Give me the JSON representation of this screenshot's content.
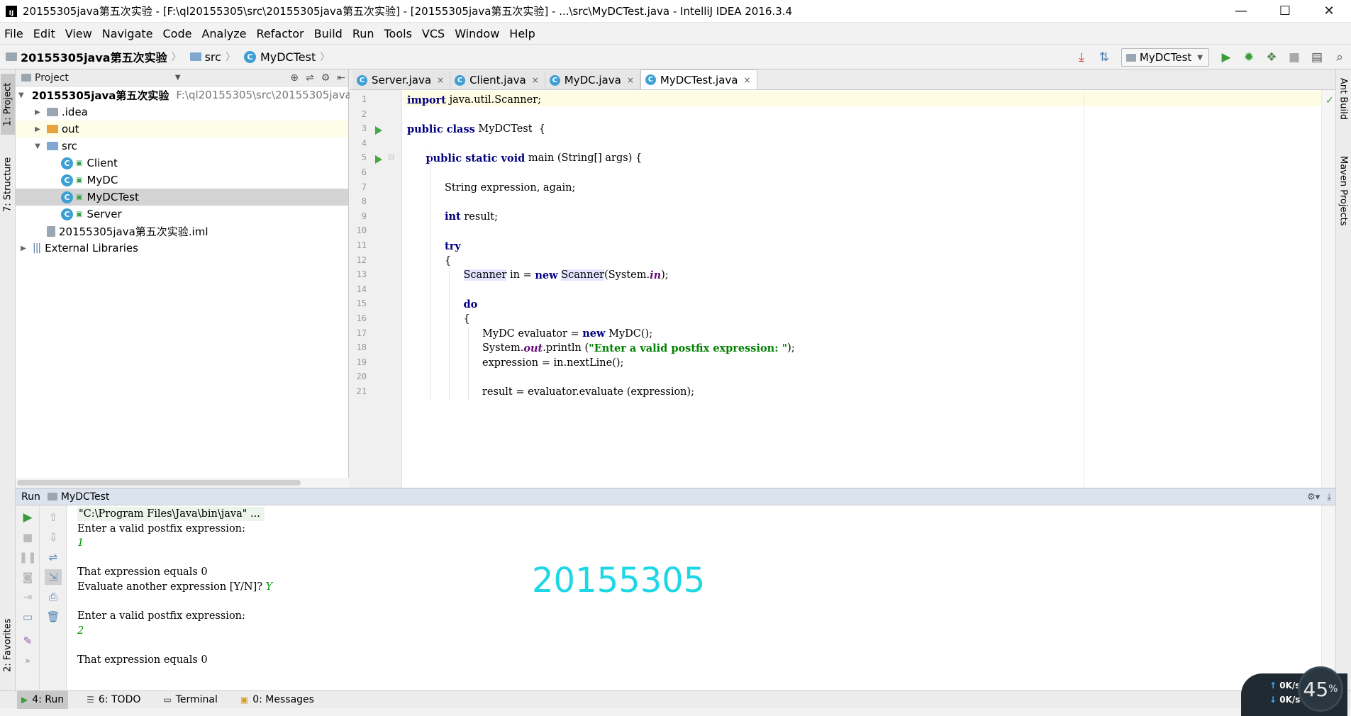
{
  "window": {
    "title": "20155305java第五次实验 - [F:\\ql20155305\\src\\20155305java第五次实验] - [20155305java第五次实验] - ...\\src\\MyDCTest.java - IntelliJ IDEA 2016.3.4",
    "minimize": "—",
    "maximize": "☐",
    "close": "✕"
  },
  "menu": [
    "File",
    "Edit",
    "View",
    "Navigate",
    "Code",
    "Analyze",
    "Refactor",
    "Build",
    "Run",
    "Tools",
    "VCS",
    "Window",
    "Help"
  ],
  "breadcrumb": {
    "project": "20155305java第五次实验",
    "folder": "src",
    "file": "MyDCTest"
  },
  "toolbar": {
    "run_config": "MyDCTest"
  },
  "left_stripe": {
    "project_tab": "1: Project",
    "structure_tab": "7: Structure",
    "favorites_tab": "2: Favorites"
  },
  "right_stripe": {
    "ant_tab": "Ant Build",
    "maven_tab": "Maven Projects"
  },
  "project_panel": {
    "title": "Project",
    "tree": [
      {
        "label": "20155305java第五次实验",
        "path": "F:\\ql20155305\\src\\20155305java",
        "indent": 0,
        "arrow": "▼",
        "icon": "module"
      },
      {
        "label": ".idea",
        "indent": 1,
        "arrow": "▶",
        "icon": "folder-gray"
      },
      {
        "label": "out",
        "indent": 1,
        "arrow": "▶",
        "icon": "folder-orange"
      },
      {
        "label": "src",
        "indent": 1,
        "arrow": "▼",
        "icon": "folder-blue"
      },
      {
        "label": "Client",
        "indent": 2,
        "arrow": "",
        "icon": "class"
      },
      {
        "label": "MyDC",
        "indent": 2,
        "arrow": "",
        "icon": "class"
      },
      {
        "label": "MyDCTest",
        "indent": 2,
        "arrow": "",
        "icon": "class",
        "selected": true
      },
      {
        "label": "Server",
        "indent": 2,
        "arrow": "",
        "icon": "class"
      },
      {
        "label": "20155305java第五次实验.iml",
        "indent": 1,
        "arrow": "",
        "icon": "iml"
      },
      {
        "label": "External Libraries",
        "indent": 0,
        "arrow": "▶",
        "icon": "library"
      }
    ]
  },
  "editor": {
    "tabs": [
      {
        "label": "Server.java",
        "active": false
      },
      {
        "label": "Client.java",
        "active": false
      },
      {
        "label": "MyDC.java",
        "active": false
      },
      {
        "label": "MyDCTest.java",
        "active": true
      }
    ],
    "close_glyph": "×",
    "line_numbers": [
      "1",
      "2",
      "3",
      "4",
      "5",
      "6",
      "7",
      "8",
      "9",
      "10",
      "11",
      "12",
      "13",
      "14",
      "15",
      "16",
      "17",
      "18",
      "19",
      "20",
      "21"
    ]
  },
  "run_panel": {
    "label": "Run",
    "config": "MyDCTest",
    "console": [
      {
        "text": "\"C:\\Program Files\\Java\\bin\\java\" ...",
        "kind": "cmd"
      },
      {
        "text": "Enter a valid postfix expression:",
        "kind": "out"
      },
      {
        "text": "1",
        "kind": "inp"
      },
      {
        "text": "",
        "kind": "out"
      },
      {
        "text": "That expression equals 0",
        "kind": "out"
      },
      {
        "text": "Evaluate another expression [Y/N]? ",
        "kind": "out",
        "input": "Y"
      },
      {
        "text": "",
        "kind": "out"
      },
      {
        "text": "Enter a valid postfix expression:",
        "kind": "out"
      },
      {
        "text": "2",
        "kind": "inp"
      },
      {
        "text": "",
        "kind": "out"
      },
      {
        "text": "That expression equals 0",
        "kind": "out"
      }
    ],
    "watermark": "20155305"
  },
  "bottom_tabs": [
    {
      "label": "4: Run",
      "icon": "run-icon",
      "active": true
    },
    {
      "label": "6: TODO",
      "icon": "todo-icon",
      "active": false
    },
    {
      "label": "Terminal",
      "icon": "terminal-icon",
      "active": false
    },
    {
      "label": "0: Messages",
      "icon": "messages-icon",
      "active": false
    }
  ],
  "speed_widget": {
    "percent": "45",
    "percent_unit": "%",
    "up": "0K/s",
    "down": "0K/s"
  }
}
